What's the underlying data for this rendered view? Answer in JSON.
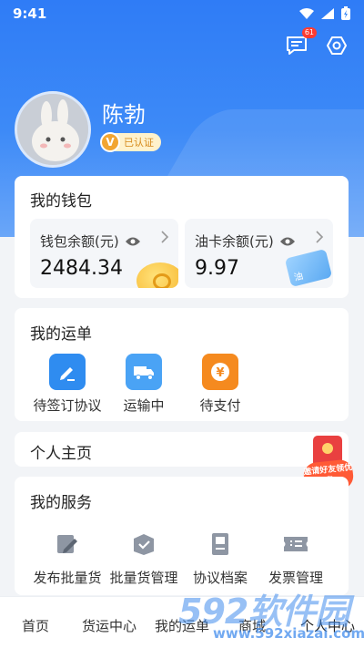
{
  "status_bar": {
    "time": "9:41"
  },
  "header": {
    "notification_count": "61"
  },
  "profile": {
    "name": "陈勃",
    "verified_label": "已认证",
    "verified_badge": "V"
  },
  "wallet": {
    "title": "我的钱包",
    "balance": {
      "label": "钱包余额(元)",
      "value": "2484.34"
    },
    "fuel_card": {
      "label": "油卡余额(元)",
      "value": "9.97",
      "card_text": "油"
    }
  },
  "waybill": {
    "title": "我的运单",
    "items": [
      {
        "label": "待签订协议",
        "icon": "pen-icon",
        "color": "#2f8cf0"
      },
      {
        "label": "运输中",
        "icon": "truck-icon",
        "color": "#4aa3f5"
      },
      {
        "label": "待支付",
        "icon": "yen-icon",
        "color": "#f58a1f"
      }
    ]
  },
  "personal_home": {
    "title": "个人主页"
  },
  "promo": {
    "text": "邀请好友领优惠"
  },
  "services": {
    "title": "我的服务",
    "items": [
      {
        "label": "发布批量货",
        "icon": "edit-icon"
      },
      {
        "label": "批量货管理",
        "icon": "box-icon"
      },
      {
        "label": "协议档案",
        "icon": "document-icon"
      },
      {
        "label": "发票管理",
        "icon": "ticket-icon"
      }
    ]
  },
  "tabbar": {
    "tabs": [
      {
        "label": "首页"
      },
      {
        "label": "货运中心"
      },
      {
        "label": "我的运单"
      },
      {
        "label": "商城"
      },
      {
        "label": "个人中心"
      }
    ]
  },
  "watermark": {
    "brand": "592软件园",
    "url": "www.592xiazai.com"
  }
}
